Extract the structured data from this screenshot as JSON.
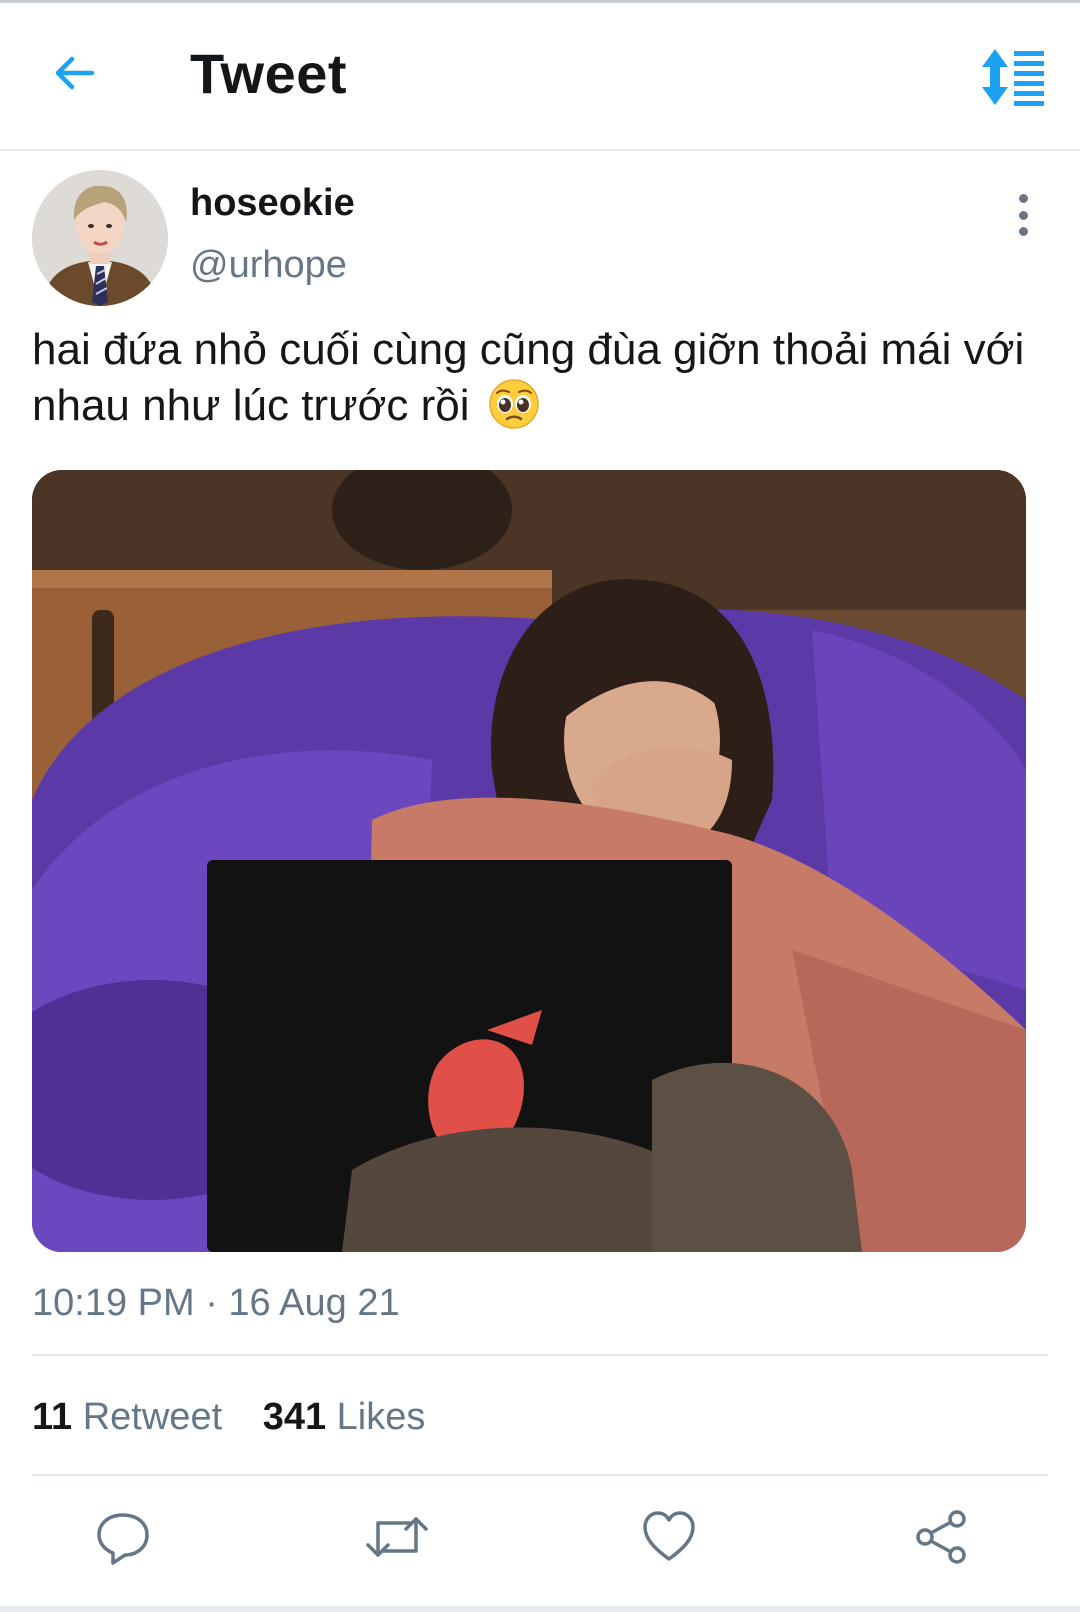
{
  "header": {
    "title": "Tweet",
    "back_icon": "arrow-left-icon",
    "sort_icon": "sort-lines-icon",
    "accent_color": "#1da1f2"
  },
  "author": {
    "display_name": "hoseokie",
    "handle": "@urhope",
    "avatar_icon": "profile-photo"
  },
  "tweet": {
    "text": "hai đứa nhỏ cuối cùng cũng đùa giỡn thoải mái với nhau như lúc trước rồi",
    "emoji": "pleading-face-emoji",
    "media": "photo-girl-with-laptop-on-purple-beanbag",
    "timestamp": "10:19 PM · 16 Aug 21"
  },
  "stats": {
    "retweet_count": "11",
    "retweet_label": "Retweet",
    "likes_count": "341",
    "likes_label": "Likes"
  },
  "actions": [
    {
      "icon": "reply-icon"
    },
    {
      "icon": "retweet-icon"
    },
    {
      "icon": "like-icon"
    },
    {
      "icon": "share-icon"
    }
  ],
  "colors": {
    "text_primary": "#14171a",
    "text_secondary": "#657786",
    "divider": "#e1e8ed"
  }
}
